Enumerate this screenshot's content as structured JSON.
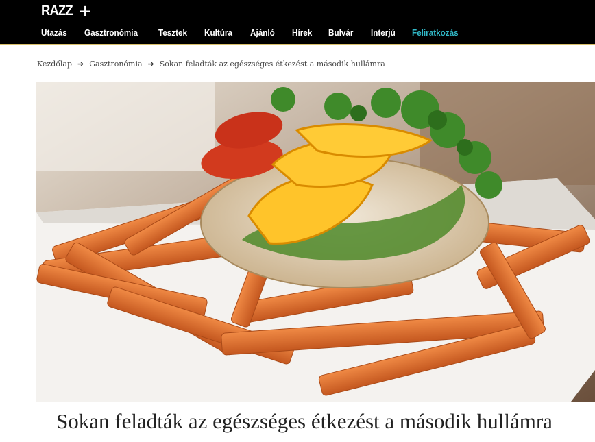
{
  "header": {
    "logo_text": "RAZZ",
    "logo_symbol": "+",
    "background": "#000000",
    "accent_color": "#31b9c8",
    "nav": [
      {
        "label": "Utazás"
      },
      {
        "label": "Gasztronómia"
      },
      {
        "label": "Tesztek"
      },
      {
        "label": "Kultúra"
      },
      {
        "label": "Ajánló"
      },
      {
        "label": "Hírek"
      },
      {
        "label": "Bulvár"
      },
      {
        "label": "Interjú"
      },
      {
        "label": "Feliratkozás",
        "accent": true
      }
    ]
  },
  "breadcrumb": {
    "items": [
      "Kezdőlap",
      "Gasztronómia",
      "Sokan feladták az egészséges étkezést a második hullámra"
    ],
    "separator_icon": "arrow-right-icon"
  },
  "hero_image": {
    "subject": "photo"
  },
  "article": {
    "title": "Sokan feladták az egészséges étkezést a második hullámra"
  }
}
